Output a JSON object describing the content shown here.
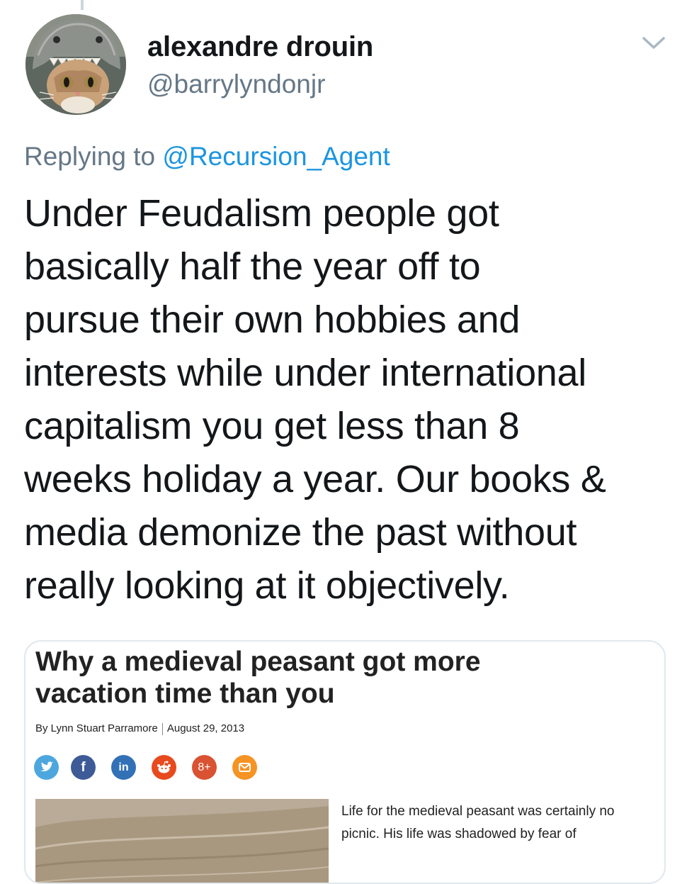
{
  "tweet": {
    "author": {
      "display_name": "alexandre drouin",
      "handle": "@barrylyndonjr",
      "avatar_icon": "cat-in-shark-hat-avatar"
    },
    "menu_icon": "chevron-down-icon",
    "reply": {
      "prefix": "Replying to",
      "mention": "@Recursion_Agent"
    },
    "text_lines": [
      "Under Feudalism people got",
      "basically half the year off to",
      "pursue their own hobbies and",
      "interests while under international",
      "capitalism you get less than 8",
      "weeks holiday a year. Our books &",
      "media demonize the past without",
      "really looking at it objectively."
    ]
  },
  "media": {
    "title_lines": [
      "Why a medieval peasant got more",
      "vacation time than you"
    ],
    "byline": {
      "author": "By Lynn Stuart Parramore",
      "date": "August 29, 2013"
    },
    "share_icons": [
      {
        "name": "twitter-icon",
        "glyph": "",
        "color": "#4da7de"
      },
      {
        "name": "facebook-icon",
        "glyph": "f",
        "color": "#3e5b98"
      },
      {
        "name": "linkedin-icon",
        "glyph": "in",
        "color": "#3371b7"
      },
      {
        "name": "reddit-icon",
        "glyph": "",
        "color": "#e74a1e"
      },
      {
        "name": "google-plus-icon",
        "glyph": "8+",
        "color": "#d95232"
      },
      {
        "name": "email-icon",
        "glyph": "",
        "color": "#f59324"
      }
    ],
    "snippet_lines": [
      "Life for the medieval peasant was certainly no",
      "picnic. His life was shadowed by fear of"
    ]
  },
  "colors": {
    "link": "#1b95e0",
    "secondary_text": "#657786",
    "primary_text": "#14171a",
    "card_border": "#e1e8ed"
  }
}
